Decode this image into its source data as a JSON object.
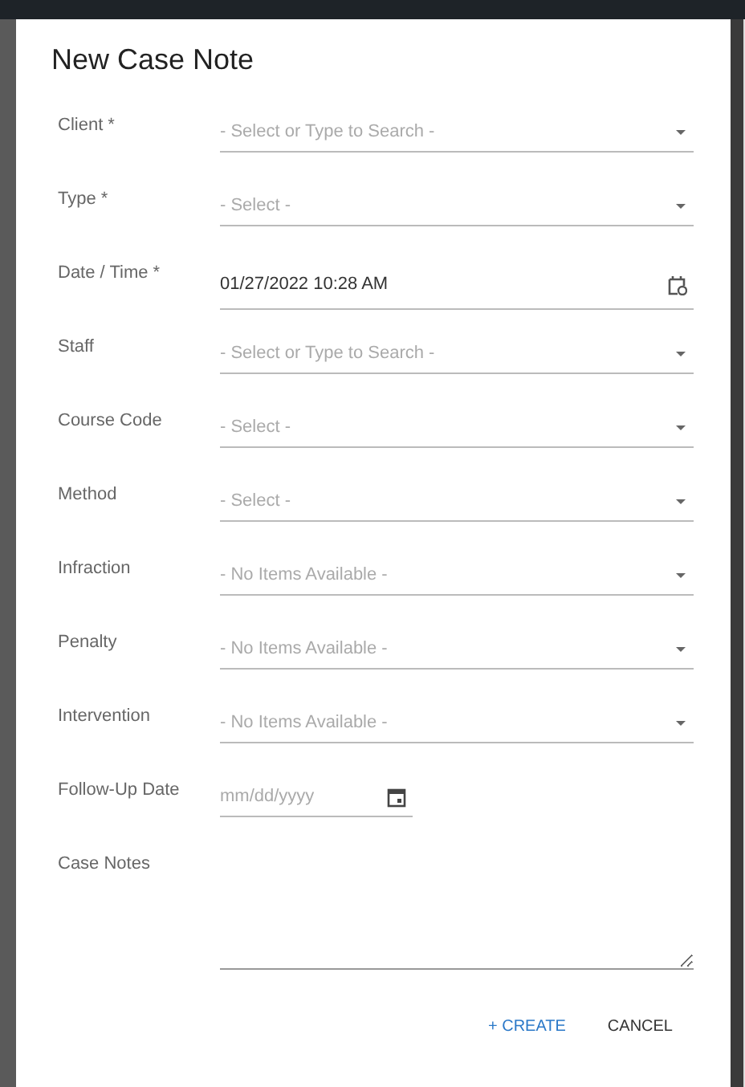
{
  "dialog": {
    "title": "New Case Note",
    "fields": [
      {
        "label": "Client *",
        "kind": "select",
        "placeholder": "- Select or Type to Search -"
      },
      {
        "label": "Type *",
        "kind": "select",
        "placeholder": "- Select -"
      },
      {
        "label": "Date / Time *",
        "kind": "datetime",
        "value": "01/27/2022 10:28 AM"
      },
      {
        "label": "Staff",
        "kind": "select",
        "placeholder": "- Select or Type to Search -"
      },
      {
        "label": "Course Code",
        "kind": "select",
        "placeholder": "- Select -"
      },
      {
        "label": "Method",
        "kind": "select",
        "placeholder": "- Select -"
      },
      {
        "label": "Infraction",
        "kind": "select",
        "placeholder": "- No Items Available -"
      },
      {
        "label": "Penalty",
        "kind": "select",
        "placeholder": "- No Items Available -"
      },
      {
        "label": "Intervention",
        "kind": "select",
        "placeholder": "- No Items Available -"
      },
      {
        "label": "Follow-Up Date",
        "kind": "date",
        "placeholder": "mm/dd/yyyy"
      },
      {
        "label": "Case Notes",
        "kind": "textarea"
      }
    ],
    "buttons": [
      {
        "label": "+ CREATE",
        "kind": "primary"
      },
      {
        "label": "CANCEL",
        "kind": "plain"
      }
    ]
  }
}
